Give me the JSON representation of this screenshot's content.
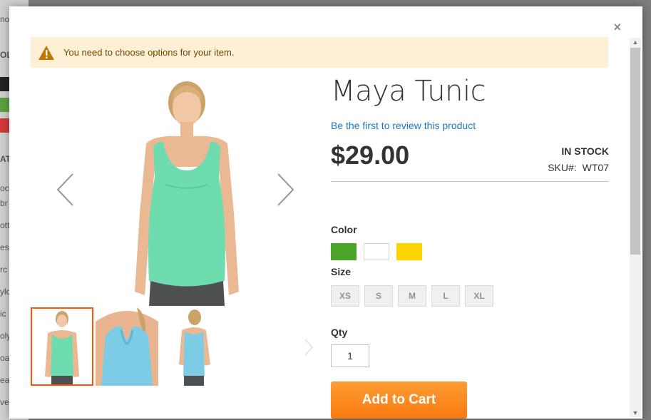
{
  "background_page": {
    "fragments": [
      "no",
      "OL",
      "AT",
      "oc",
      "br",
      "ott",
      "es",
      "rc",
      "ylo",
      "ic",
      "oly",
      "oa",
      "ea",
      "ver"
    ],
    "strip_colors": [
      "#222222",
      "#5ba33e",
      "#d43a3a"
    ]
  },
  "modal": {
    "close_symbol": "×"
  },
  "message": {
    "text": "You need to choose options for your item."
  },
  "product": {
    "name": "Maya Tunic",
    "review_link": "Be the first to review this product",
    "price": "$29.00",
    "stock": "IN STOCK",
    "sku_label": "SKU#:",
    "sku": "WT07"
  },
  "options": {
    "color_label": "Color",
    "colors": [
      "#4aa528",
      "#ffffff",
      "#ffd500"
    ],
    "size_label": "Size",
    "sizes": [
      "XS",
      "S",
      "M",
      "L",
      "XL"
    ],
    "qty_label": "Qty",
    "qty_value": "1"
  },
  "actions": {
    "add_to_cart": "Add to Cart"
  },
  "gallery": {
    "thumbnails": [
      "front-view",
      "back-view",
      "side-view"
    ],
    "product_color": "#6fdcb0",
    "alt_color": "#7ccce5"
  }
}
